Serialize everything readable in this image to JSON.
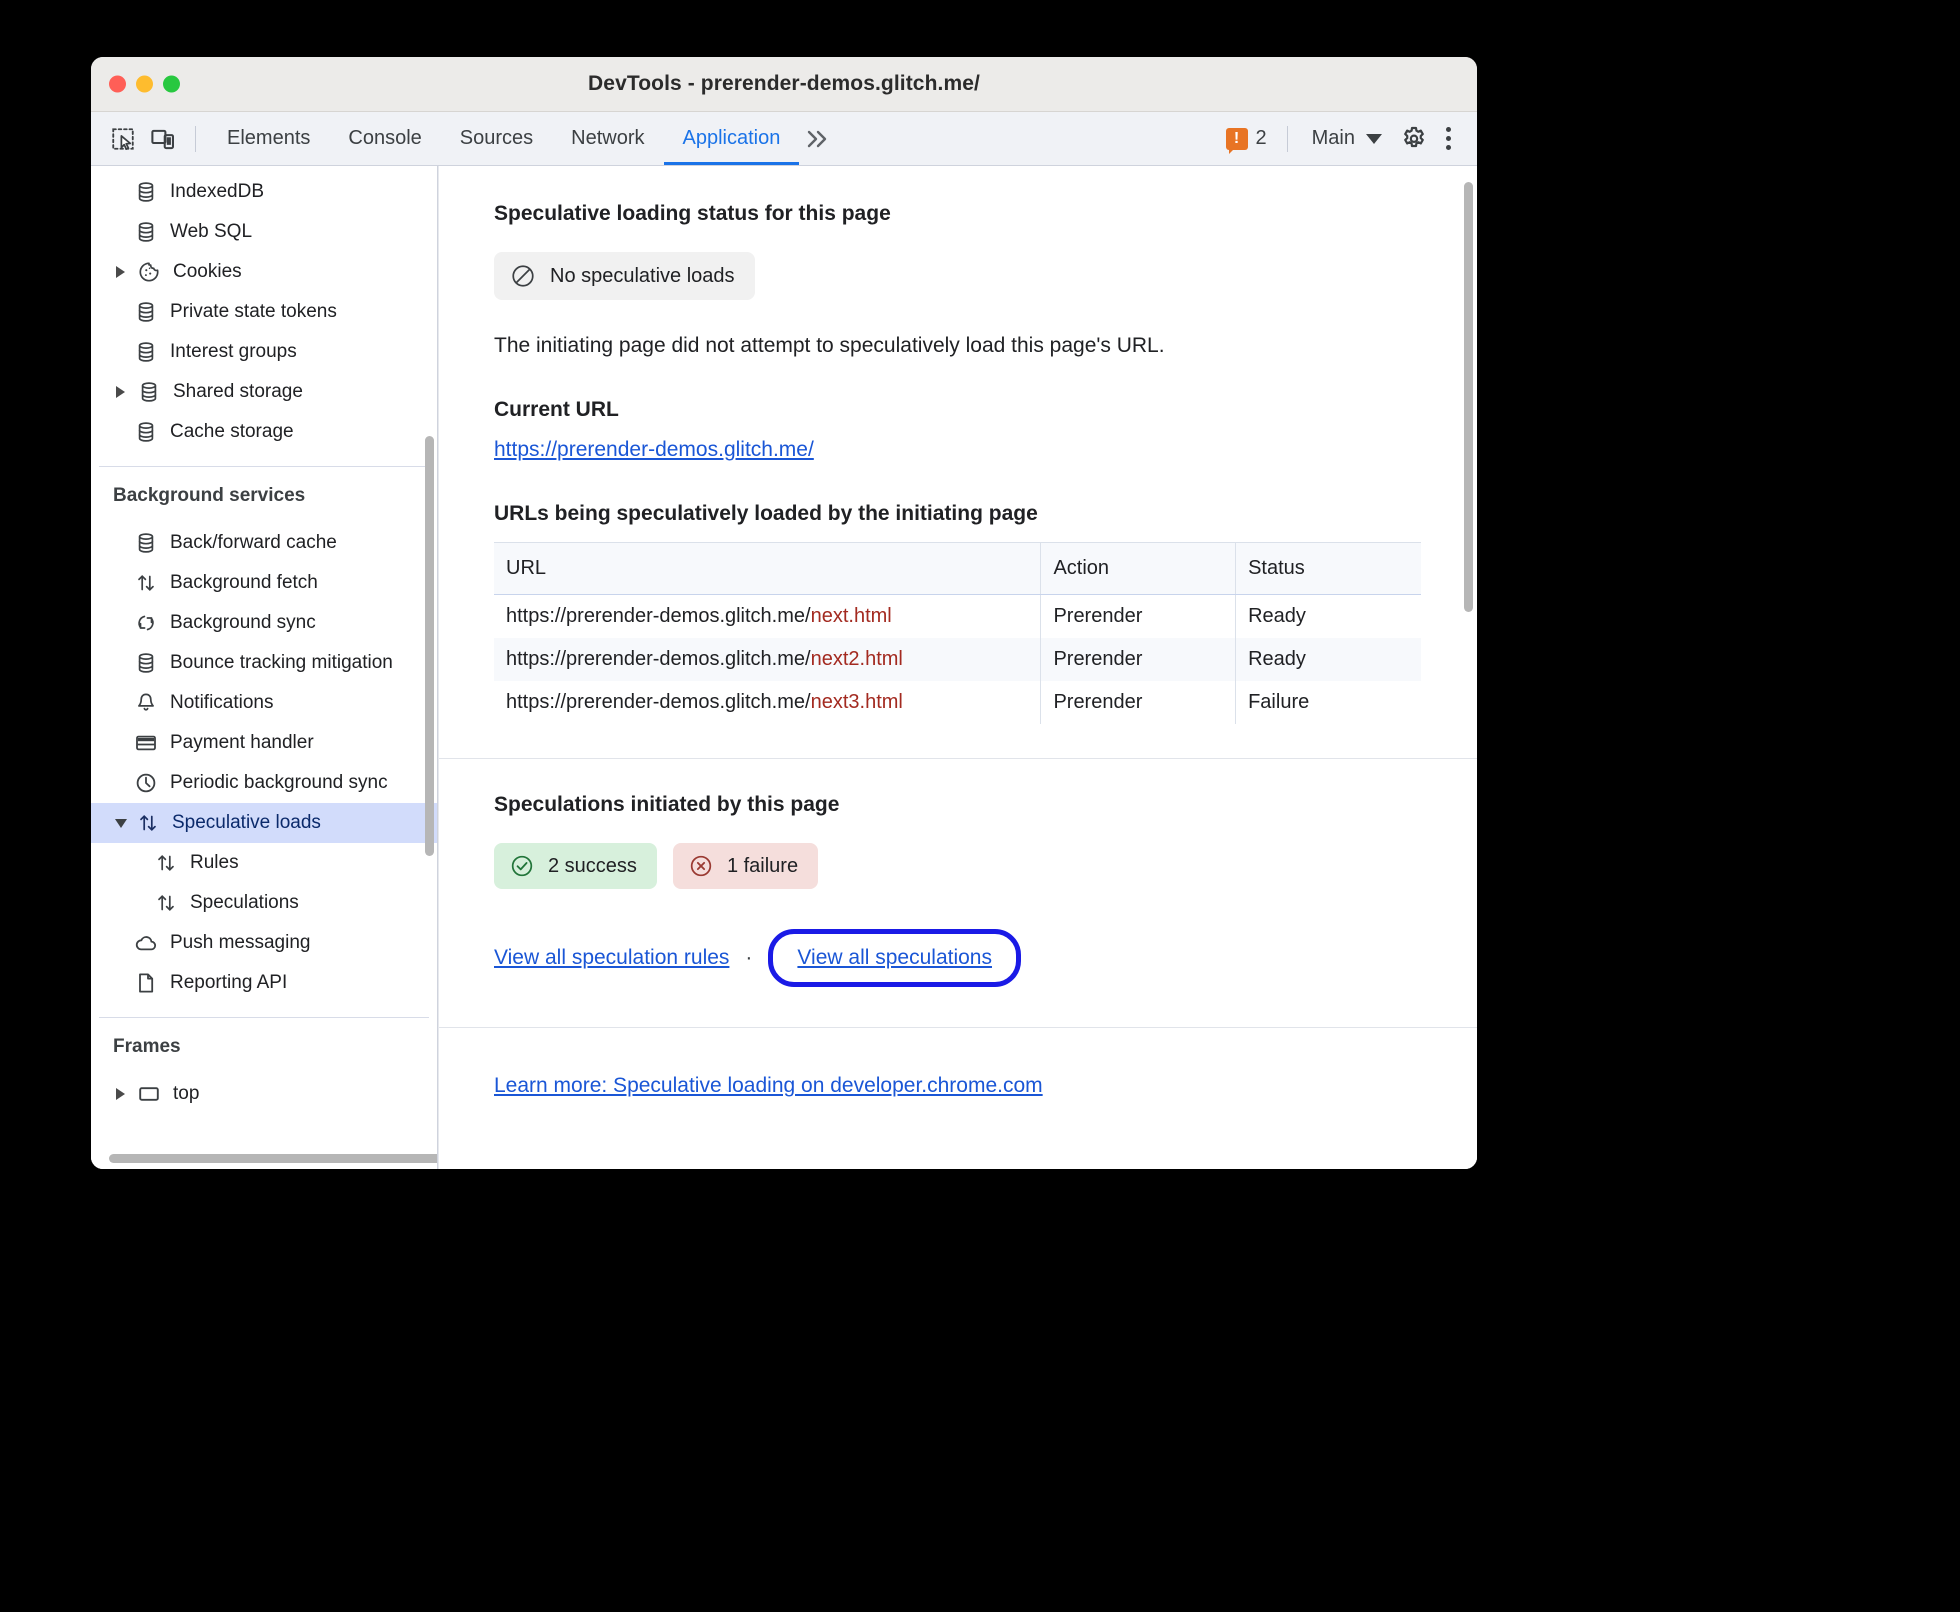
{
  "window": {
    "title": "DevTools - prerender-demos.glitch.me/"
  },
  "toolbar": {
    "inspect_icon": "inspect-element-icon",
    "device_icon": "device-toolbar-icon",
    "tabs": [
      {
        "label": "Elements",
        "active": false
      },
      {
        "label": "Console",
        "active": false
      },
      {
        "label": "Sources",
        "active": false
      },
      {
        "label": "Network",
        "active": false
      },
      {
        "label": "Application",
        "active": true
      }
    ],
    "more_tabs": "»",
    "warning_count": "2",
    "warning_glyph": "!",
    "context_selector": "Main",
    "settings_icon": "gear-icon",
    "menu_icon": "kebab-menu-icon",
    "accent_color": "#1a73e8",
    "warning_color": "#e87424"
  },
  "sidebar": {
    "storage_items": [
      {
        "label": "IndexedDB",
        "icon": "database-icon",
        "arrow": "none"
      },
      {
        "label": "Web SQL",
        "icon": "database-icon",
        "arrow": "none"
      },
      {
        "label": "Cookies",
        "icon": "cookie-icon",
        "arrow": "right"
      },
      {
        "label": "Private state tokens",
        "icon": "database-icon",
        "arrow": "none"
      },
      {
        "label": "Interest groups",
        "icon": "database-icon",
        "arrow": "none"
      },
      {
        "label": "Shared storage",
        "icon": "database-icon",
        "arrow": "right"
      },
      {
        "label": "Cache storage",
        "icon": "database-icon",
        "arrow": "none"
      }
    ],
    "background_services_title": "Background services",
    "background_items": [
      {
        "label": "Back/forward cache",
        "icon": "database-icon",
        "arrow": "none",
        "selected": false,
        "indent": 1
      },
      {
        "label": "Background fetch",
        "icon": "updown-arrows-icon",
        "arrow": "none",
        "selected": false,
        "indent": 1
      },
      {
        "label": "Background sync",
        "icon": "sync-icon",
        "arrow": "none",
        "selected": false,
        "indent": 1
      },
      {
        "label": "Bounce tracking mitigation",
        "icon": "database-icon",
        "arrow": "none",
        "selected": false,
        "indent": 1
      },
      {
        "label": "Notifications",
        "icon": "bell-icon",
        "arrow": "none",
        "selected": false,
        "indent": 1
      },
      {
        "label": "Payment handler",
        "icon": "credit-card-icon",
        "arrow": "none",
        "selected": false,
        "indent": 1
      },
      {
        "label": "Periodic background sync",
        "icon": "clock-icon",
        "arrow": "none",
        "selected": false,
        "indent": 1
      },
      {
        "label": "Speculative loads",
        "icon": "updown-arrows-icon",
        "arrow": "down",
        "selected": true,
        "indent": 1
      },
      {
        "label": "Rules",
        "icon": "updown-arrows-icon",
        "arrow": "none",
        "selected": false,
        "indent": 2
      },
      {
        "label": "Speculations",
        "icon": "updown-arrows-icon",
        "arrow": "none",
        "selected": false,
        "indent": 2
      },
      {
        "label": "Push messaging",
        "icon": "cloud-icon",
        "arrow": "none",
        "selected": false,
        "indent": 1
      },
      {
        "label": "Reporting API",
        "icon": "document-icon",
        "arrow": "none",
        "selected": false,
        "indent": 1
      }
    ],
    "frames_title": "Frames",
    "frames_items": [
      {
        "label": "top",
        "icon": "frame-icon",
        "arrow": "right"
      }
    ],
    "selected_bg": "#d2dcfb"
  },
  "main": {
    "status_heading": "Speculative loading status for this page",
    "status_chip": {
      "icon": "no-entry-icon",
      "label": "No speculative loads"
    },
    "status_description": "The initiating page did not attempt to speculatively load this page's URL.",
    "current_url_heading": "Current URL",
    "current_url": "https://prerender-demos.glitch.me/",
    "table_heading": "URLs being speculatively loaded by the initiating page",
    "table": {
      "columns": [
        "URL",
        "Action",
        "Status"
      ],
      "rows": [
        {
          "url_base": "https://prerender-demos.glitch.me/",
          "url_highlight": "next.html",
          "action": "Prerender",
          "status": "Ready"
        },
        {
          "url_base": "https://prerender-demos.glitch.me/",
          "url_highlight": "next2.html",
          "action": "Prerender",
          "status": "Ready"
        },
        {
          "url_base": "https://prerender-demos.glitch.me/",
          "url_highlight": "next3.html",
          "action": "Prerender",
          "status": "Failure"
        }
      ]
    },
    "speculations_heading": "Speculations initiated by this page",
    "badges": [
      {
        "icon": "check-circle-icon",
        "label": "2 success",
        "kind": "success"
      },
      {
        "icon": "x-circle-icon",
        "label": "1 failure",
        "kind": "failure"
      }
    ],
    "links": {
      "view_rules": "View all speculation rules",
      "separator": "·",
      "view_speculations": "View all speculations",
      "learn_more": "Learn more: Speculative loading on developer.chrome.com"
    },
    "annotation_color": "#1a1ae6",
    "link_color": "#1a56d6",
    "highlight_color": "#a32a20"
  }
}
